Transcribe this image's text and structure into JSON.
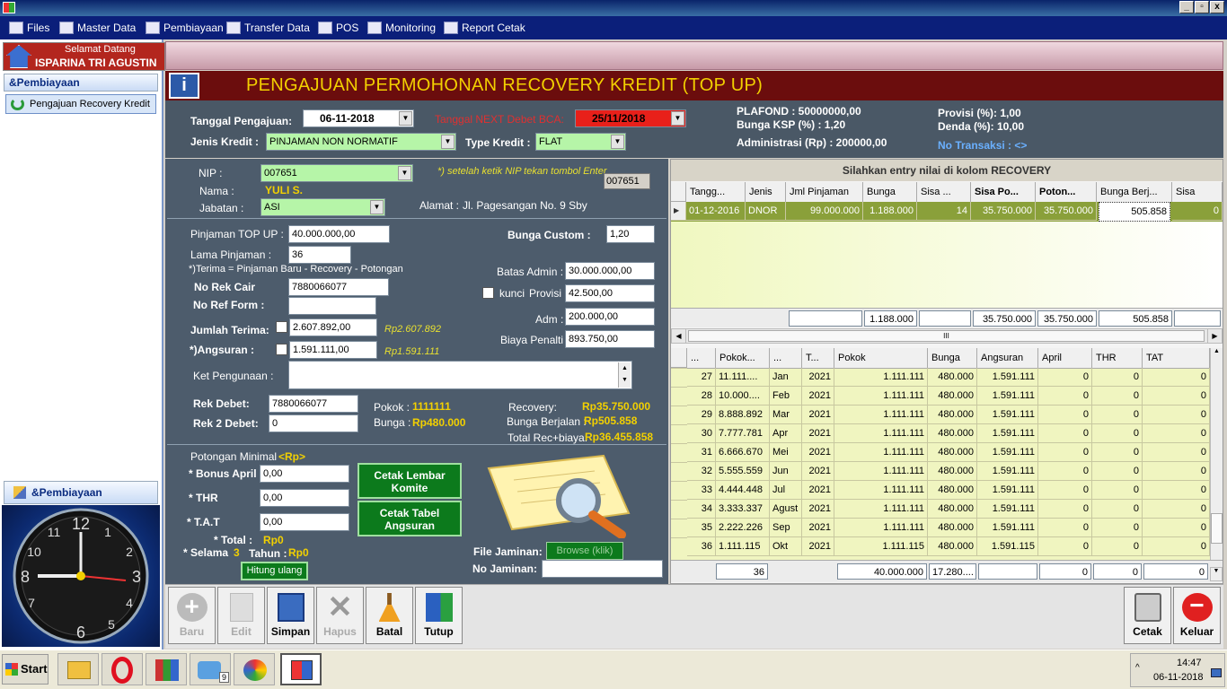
{
  "menu": {
    "items": [
      "Files",
      "Master Data",
      "Pembiayaan",
      "Transfer Data",
      "POS",
      "Monitoring",
      "Report Cetak"
    ],
    "window_buttons": [
      "_",
      "▫",
      "x"
    ]
  },
  "sidebar": {
    "welcome_line1": "Selamat Datang",
    "welcome_line2": "ISPARINA TRI AGUSTIN",
    "section1": "&Pembiayaan",
    "item1": "Pengajuan Recovery Kredit",
    "section2": "&Pembiayaan",
    "clock_numbers": [
      "12",
      "1",
      "2",
      "3",
      "4",
      "5",
      "6",
      "7",
      "8",
      "9",
      "10",
      "11"
    ]
  },
  "form": {
    "title": "PENGAJUAN PERMOHONAN RECOVERY KREDIT (TOP UP)",
    "tanggal_pengajuan_label": "Tanggal Pengajuan:",
    "tanggal_pengajuan_value": "06-11-2018",
    "tanggal_next_label": "Tanggal NEXT Debet BCA:",
    "tanggal_next_value": "25/11/2018",
    "jenis_kredit_label": "Jenis Kredit :",
    "jenis_kredit_value": "PINJAMAN NON NORMATIF",
    "type_kredit_label": "Type Kredit :",
    "type_kredit_value": "FLAT",
    "plafond": "PLAFOND :  50000000,00",
    "bunga_ksp": "Bunga KSP (%) :   1,20",
    "administrasi": "Administrasi (Rp) :  200000,00",
    "provisi": "Provisi (%):  1,00",
    "denda": "Denda (%):  10,00",
    "no_transaksi": "No Transaksi :  <>"
  },
  "member": {
    "nip_label": "NIP :",
    "nip_value": "007651",
    "nip_hint": "*) setelah ketik NIP tekan tombol Enter",
    "nip_echo": "007651",
    "nama_label": "Nama :",
    "nama_value": "YULI S.",
    "jabatan_label": "Jabatan :",
    "jabatan_value": "ASI",
    "alamat_label": "Alamat :",
    "alamat_value": "Jl. Pagesangan No. 9 Sby"
  },
  "loan": {
    "pinjaman_label": "Pinjaman TOP UP :",
    "pinjaman_value": "40.000.000,00",
    "bunga_custom_label": "Bunga Custom :",
    "bunga_custom_value": "1,20",
    "lama_label": "Lama Pinjaman :",
    "lama_value": "36",
    "terima_note": "*)Terima = Pinjaman Baru - Recovery - Potongan",
    "batas_admin_label": "Batas Admin :",
    "batas_admin_value": "30.000.000,00",
    "no_rek_cair_label": "No Rek Cair",
    "no_rek_cair_value": "7880066077",
    "kunci_label": "kunci",
    "provisi_label": "Provisi :",
    "provisi_value": "42.500,00",
    "no_ref_label": "No Ref Form :",
    "no_ref_value": "",
    "adm_label": "Adm :",
    "adm_value": "200.000,00",
    "jumlah_terima_label": "Jumlah Terima:",
    "jumlah_terima_value": "2.607.892,00",
    "jumlah_terima_rp": "Rp2.607.892",
    "biaya_penalti_label": "Biaya Penalti :",
    "biaya_penalti_value": "893.750,00",
    "angsuran_label": "*)Angsuran :",
    "angsuran_value": "1.591.111,00",
    "angsuran_rp": "Rp1.591.111",
    "ket_label": "Ket Pengunaan :",
    "ket_value": "",
    "rek_debet_label": "Rek Debet:",
    "rek_debet_value": "7880066077",
    "rek2_label": "Rek 2 Debet:",
    "rek2_value": "0",
    "pokok_label": "Pokok :",
    "pokok_value": "1111111",
    "bunga_label": "Bunga :",
    "bunga_value": "Rp480.000",
    "recovery_label": "Recovery:",
    "recovery_value": "Rp35.750.000",
    "bunga_berjalan_label": "Bunga Berjalan :",
    "bunga_berjalan_value": "Rp505.858",
    "total_rec_label": "Total Rec+biaya:",
    "total_rec_value": "Rp36.455.858"
  },
  "potongan": {
    "title": "Potongan Minimal",
    "rp": "<Rp>",
    "bonus_label": "* Bonus April",
    "bonus_value": "0,00",
    "thr_label": "* THR",
    "thr_value": "0,00",
    "tat_label": "* T.A.T",
    "tat_value": "0,00",
    "total_label": "* Total :",
    "total_value": "Rp0",
    "selama_label": "* Selama",
    "selama_value": "3",
    "tahun_label": "Tahun :",
    "tahun_value": "Rp0",
    "hitung_button": "Hitung ulang",
    "cetak_komite": "Cetak Lembar Komite",
    "cetak_tabel": "Cetak Tabel Angsuran",
    "file_jaminan_label": "File Jaminan:",
    "browse_button": "Browse (klik)",
    "no_jaminan_label": "No Jaminan:",
    "no_jaminan_value": ""
  },
  "recovery_grid": {
    "caption": "Silahkan entry nilai di kolom RECOVERY",
    "headers": [
      "Tangg...",
      "Jenis",
      "Jml Pinjaman",
      "Bunga",
      "Sisa ...",
      "Sisa Po...",
      "Poton...",
      "Bunga Berj...",
      "Sisa"
    ],
    "row": [
      "01-12-2016",
      "DNOR",
      "99.000.000",
      "1.188.000",
      "14",
      "35.750.000",
      "35.750.000",
      "505.858",
      "0"
    ],
    "totals": [
      "",
      "1.188.000",
      "",
      "35.750.000",
      "35.750.000",
      "505.858",
      ""
    ],
    "scroll_label": "III"
  },
  "schedule_grid": {
    "headers": [
      "...",
      "Pokok...",
      "...",
      "T...",
      "Pokok",
      "Bunga",
      "Angsuran",
      "April",
      "THR",
      "TAT"
    ],
    "rows": [
      [
        "27",
        "11.111....",
        "Jan",
        "2021",
        "1.111.111",
        "480.000",
        "1.591.111",
        "0",
        "0",
        "0"
      ],
      [
        "28",
        "10.000....",
        "Feb",
        "2021",
        "1.111.111",
        "480.000",
        "1.591.111",
        "0",
        "0",
        "0"
      ],
      [
        "29",
        "8.888.892",
        "Mar",
        "2021",
        "1.111.111",
        "480.000",
        "1.591.111",
        "0",
        "0",
        "0"
      ],
      [
        "30",
        "7.777.781",
        "Apr",
        "2021",
        "1.111.111",
        "480.000",
        "1.591.111",
        "0",
        "0",
        "0"
      ],
      [
        "31",
        "6.666.670",
        "Mei",
        "2021",
        "1.111.111",
        "480.000",
        "1.591.111",
        "0",
        "0",
        "0"
      ],
      [
        "32",
        "5.555.559",
        "Jun",
        "2021",
        "1.111.111",
        "480.000",
        "1.591.111",
        "0",
        "0",
        "0"
      ],
      [
        "33",
        "4.444.448",
        "Jul",
        "2021",
        "1.111.111",
        "480.000",
        "1.591.111",
        "0",
        "0",
        "0"
      ],
      [
        "34",
        "3.333.337",
        "Agust",
        "2021",
        "1.111.111",
        "480.000",
        "1.591.111",
        "0",
        "0",
        "0"
      ],
      [
        "35",
        "2.222.226",
        "Sep",
        "2021",
        "1.111.111",
        "480.000",
        "1.591.111",
        "0",
        "0",
        "0"
      ],
      [
        "36",
        "1.111.115",
        "Okt",
        "2021",
        "1.111.115",
        "480.000",
        "1.591.115",
        "0",
        "0",
        "0"
      ]
    ],
    "totals": [
      "36",
      "40.000.000",
      "17.280....",
      "",
      "0",
      "0",
      "0"
    ]
  },
  "toolbar": {
    "baru": "Baru",
    "edit": "Edit",
    "simpan": "Simpan",
    "hapus": "Hapus",
    "batal": "Batal",
    "tutup": "Tutup",
    "cetak": "Cetak",
    "keluar": "Keluar"
  },
  "taskbar": {
    "start": "Start",
    "time": "14:47",
    "date": "06-11-2018",
    "badge": "9"
  },
  "colors": {
    "header_bg": "#6b0d0d",
    "title_yellow": "#f2d000",
    "panel_bg": "#4d5c6c",
    "grid_green": "#f0f5c0",
    "selected_row": "#8aa03a",
    "button_green": "#0c7a1c"
  }
}
